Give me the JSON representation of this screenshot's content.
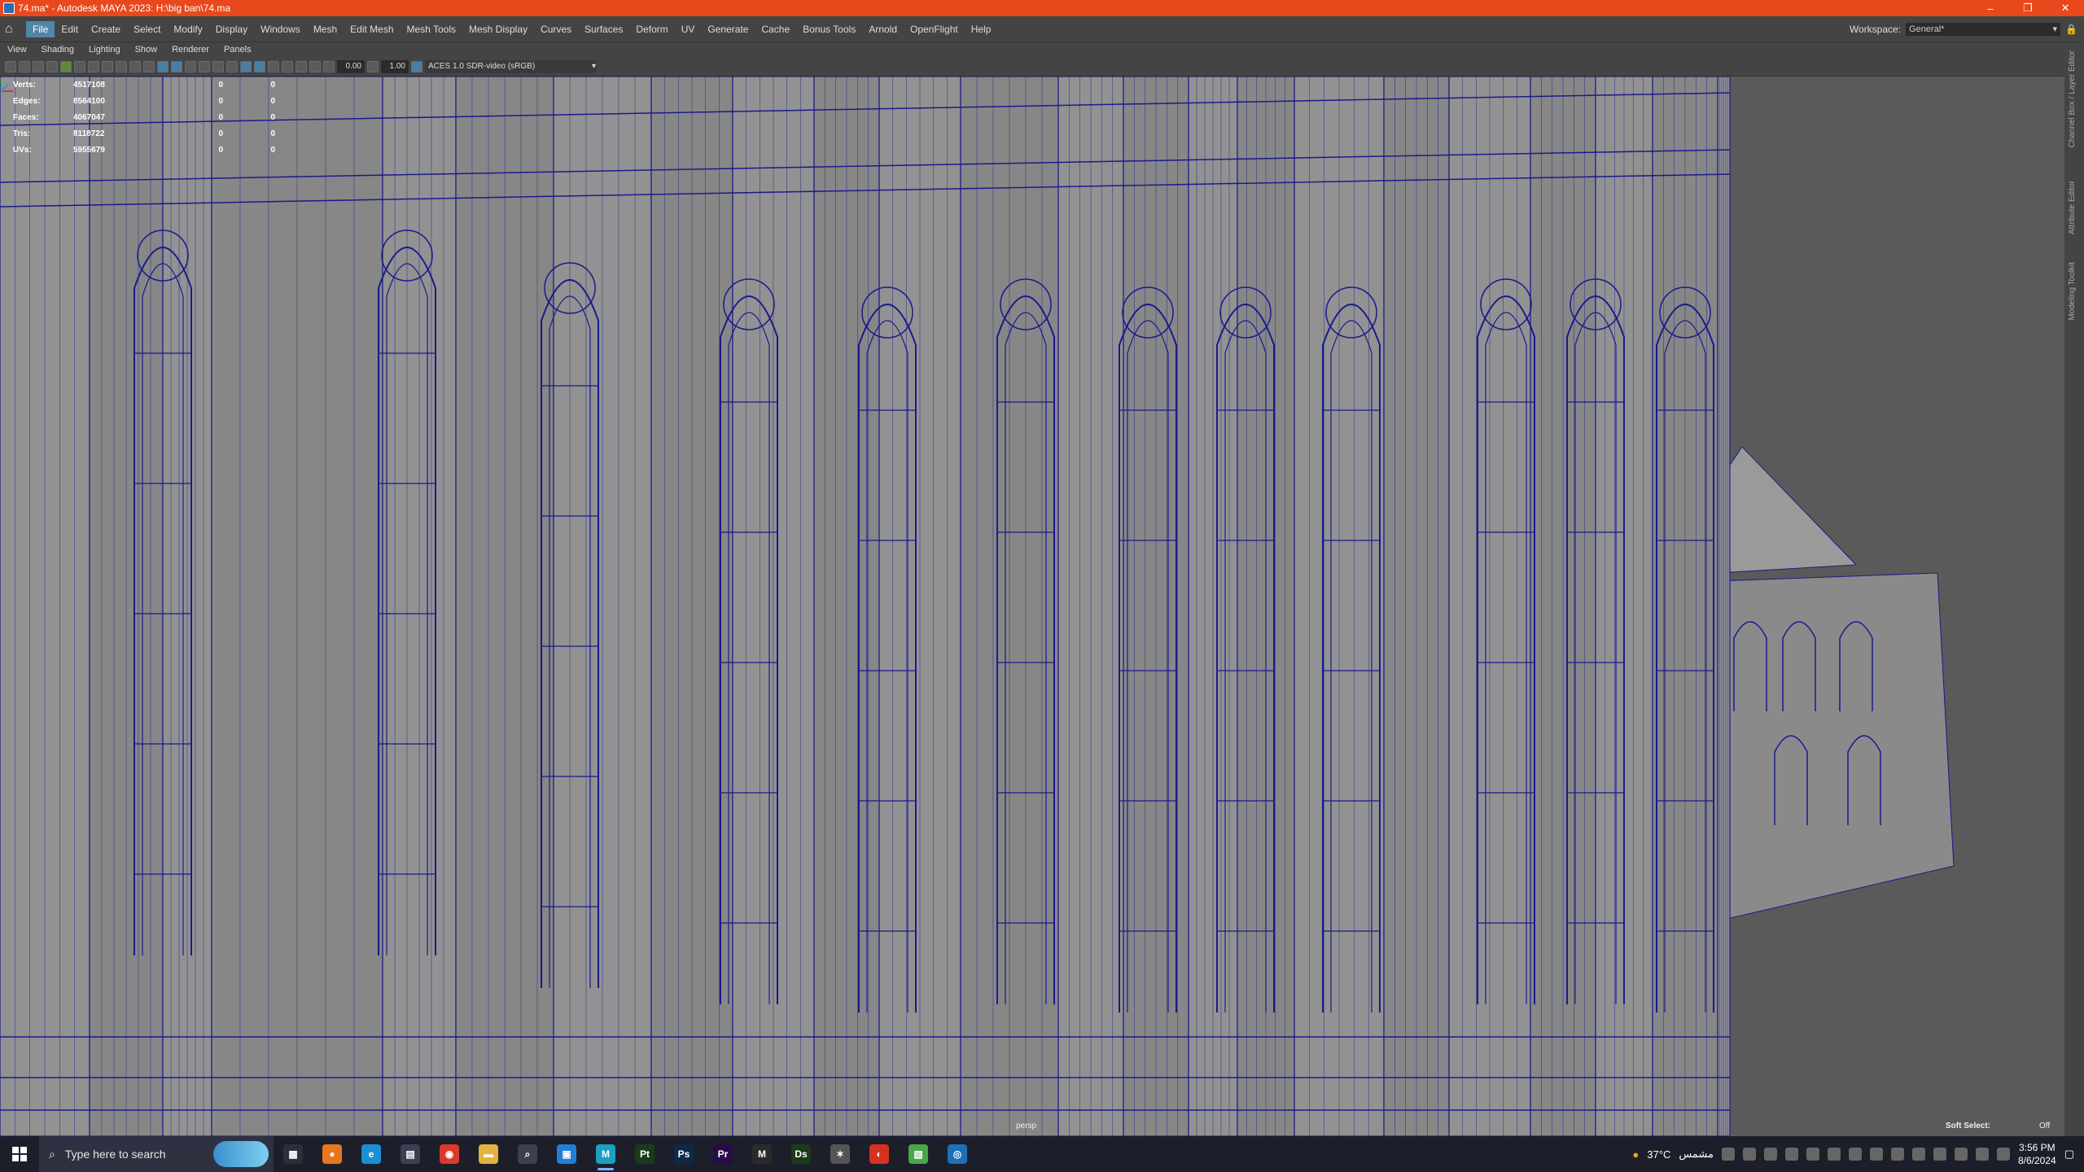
{
  "window": {
    "title": "74.ma* - Autodesk MAYA 2023: H:\\big ban\\74.ma",
    "controls": [
      "–",
      "❐",
      "✕"
    ]
  },
  "menubar": {
    "items": [
      "File",
      "Edit",
      "Create",
      "Select",
      "Modify",
      "Display",
      "Windows",
      "Mesh",
      "Edit Mesh",
      "Mesh Tools",
      "Mesh Display",
      "Curves",
      "Surfaces",
      "Deform",
      "UV",
      "Generate",
      "Cache",
      "Bonus Tools",
      "Arnold",
      "OpenFlight",
      "Help"
    ],
    "active": "File",
    "workspace_label": "Workspace:",
    "workspace_value": "General*"
  },
  "panel_menu": {
    "items": [
      "View",
      "Shading",
      "Lighting",
      "Show",
      "Renderer",
      "Panels"
    ]
  },
  "panel_toolbar": {
    "exposure": "0.00",
    "gamma": "1.00",
    "color_space": "ACES 1.0 SDR-video (sRGB)"
  },
  "hud": {
    "rows": [
      {
        "label": "Verts:",
        "value": "4517108",
        "sel": "0",
        "comp": "0"
      },
      {
        "label": "Edges:",
        "value": "8564100",
        "sel": "0",
        "comp": "0"
      },
      {
        "label": "Faces:",
        "value": "4067047",
        "sel": "0",
        "comp": "0"
      },
      {
        "label": "Tris:",
        "value": "8118722",
        "sel": "0",
        "comp": "0"
      },
      {
        "label": "UVs:",
        "value": "5955679",
        "sel": "0",
        "comp": "0"
      }
    ],
    "camera": "persp",
    "soft_select_label": "Soft Select:",
    "soft_select_value": "Off"
  },
  "side_tabs": [
    "Channel Box / Layer Editor",
    "Attribute Editor",
    "Modeling Toolkit"
  ],
  "taskbar": {
    "search_placeholder": "Type here to search",
    "apps": [
      {
        "name": "task-view",
        "glyph": "▦",
        "color": "#2a2f3d"
      },
      {
        "name": "firefox",
        "glyph": "●",
        "color": "#e8771c"
      },
      {
        "name": "edge",
        "glyph": "e",
        "color": "#1a8fd6"
      },
      {
        "name": "store",
        "glyph": "▤",
        "color": "#3a3f52"
      },
      {
        "name": "chrome",
        "glyph": "◉",
        "color": "#d93a2b"
      },
      {
        "name": "explorer",
        "glyph": "▬",
        "color": "#e3b341"
      },
      {
        "name": "search-app",
        "glyph": "⌕",
        "color": "#3a3f52"
      },
      {
        "name": "app-blue",
        "glyph": "▣",
        "color": "#1f7fd6"
      },
      {
        "name": "maya",
        "glyph": "M",
        "color": "#1aa0c0"
      },
      {
        "name": "substance-painter",
        "glyph": "Pt",
        "color": "#1b3a1b"
      },
      {
        "name": "photoshop",
        "glyph": "Ps",
        "color": "#0b2a4a"
      },
      {
        "name": "premiere",
        "glyph": "Pr",
        "color": "#2a0b4a"
      },
      {
        "name": "marmoset",
        "glyph": "M",
        "color": "#2a2a2a"
      },
      {
        "name": "substance-designer",
        "glyph": "Ds",
        "color": "#1b3a1b"
      },
      {
        "name": "app-star",
        "glyph": "✶",
        "color": "#555"
      },
      {
        "name": "app-red",
        "glyph": "◐",
        "color": "#d5311f"
      },
      {
        "name": "app-image",
        "glyph": "▧",
        "color": "#4aa64a"
      },
      {
        "name": "app-cycle",
        "glyph": "◎",
        "color": "#1e6fb5"
      }
    ],
    "weather_temp": "37°C",
    "weather_text": "مشمس",
    "time": "3:56 PM",
    "date": "8/6/2024"
  },
  "colors": {
    "titlebar": "#e8481c",
    "wireframe": "#1a1a8c",
    "surface": "#8a8a8a",
    "background": "#5a5a5a"
  }
}
